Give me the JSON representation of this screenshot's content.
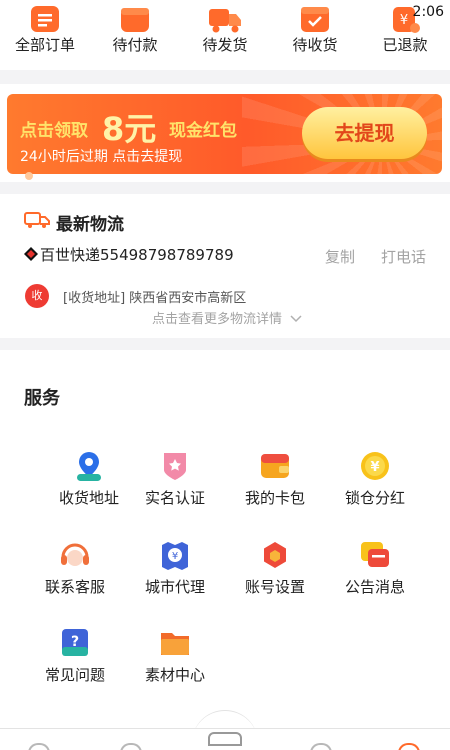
{
  "status_bar": {
    "time": "2:06"
  },
  "orders": [
    {
      "label": "全部订单",
      "icon": "all-orders-icon"
    },
    {
      "label": "待付款",
      "icon": "wallet-icon"
    },
    {
      "label": "待发货",
      "icon": "truck-icon"
    },
    {
      "label": "待收货",
      "icon": "receive-box-icon"
    },
    {
      "label": "已退款",
      "icon": "refund-icon"
    }
  ],
  "banner": {
    "prefix": "点击领取",
    "amount": "8元",
    "suffix": "现金红包",
    "subtitle": "24小时后过期   点击去提现",
    "button": "去提现"
  },
  "logistics": {
    "title": "最新物流",
    "tracking": "百世快递55498798789789",
    "copy": "复制",
    "call": "打电话",
    "receive_badge": "收",
    "address": "[收货地址] 陕西省西安市高新区",
    "more": "点击查看更多物流详情"
  },
  "services": {
    "title": "服务",
    "items": [
      {
        "label": "收货地址",
        "icon": "location-icon"
      },
      {
        "label": "实名认证",
        "icon": "id-shield-icon"
      },
      {
        "label": "我的卡包",
        "icon": "card-wallet-icon"
      },
      {
        "label": "锁仓分红",
        "icon": "yen-coin-icon"
      },
      {
        "label": "联系客服",
        "icon": "headset-icon"
      },
      {
        "label": "城市代理",
        "icon": "city-agent-icon"
      },
      {
        "label": "账号设置",
        "icon": "settings-hexagon-icon"
      },
      {
        "label": "公告消息",
        "icon": "notice-message-icon"
      },
      {
        "label": "常见问题",
        "icon": "faq-icon"
      },
      {
        "label": "素材中心",
        "icon": "folder-icon"
      }
    ]
  },
  "colors": {
    "accent": "#ff5a2a",
    "gold": "#ffc53d",
    "badge_red": "#ee3b33"
  }
}
